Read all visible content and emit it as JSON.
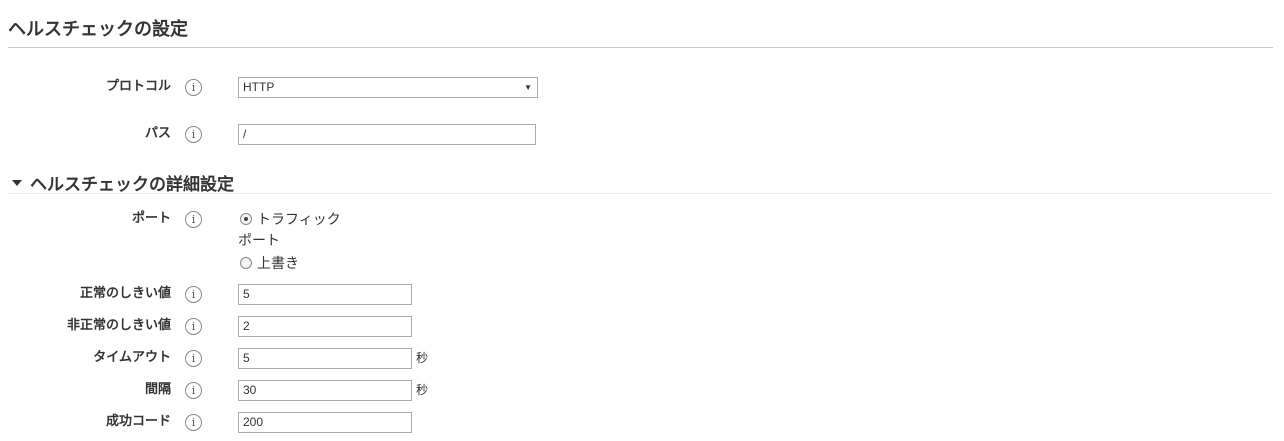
{
  "page": {
    "title": "ヘルスチェックの設定",
    "advanced_title": "ヘルスチェックの詳細設定"
  },
  "basic": {
    "protocol": {
      "label": "プロトコル",
      "value": "HTTP",
      "info_glyph": "i"
    },
    "path": {
      "label": "パス",
      "value": "/",
      "info_glyph": "i"
    }
  },
  "advanced": {
    "port": {
      "label": "ポート",
      "info_glyph": "i",
      "options": [
        {
          "label_line1": "トラフィック",
          "label_line2": "ポート",
          "checked": true
        },
        {
          "label_line1": "上書き",
          "checked": false
        }
      ]
    },
    "healthy_threshold": {
      "label": "正常のしきい値",
      "value": "5",
      "info_glyph": "i"
    },
    "unhealthy_threshold": {
      "label": "非正常のしきい値",
      "value": "2",
      "info_glyph": "i"
    },
    "timeout": {
      "label": "タイムアウト",
      "value": "5",
      "unit": "秒",
      "info_glyph": "i"
    },
    "interval": {
      "label": "間隔",
      "value": "30",
      "unit": "秒",
      "info_glyph": "i"
    },
    "success_codes": {
      "label": "成功コード",
      "value": "200",
      "info_glyph": "i"
    }
  },
  "icons": {
    "info": "info-icon",
    "caret": "caret-down-icon",
    "select_arrow": "dropdown-arrow-icon"
  },
  "colors": {
    "text": "#333333",
    "rule": "#c8c8c8",
    "field_border": "#a9a9a9"
  }
}
